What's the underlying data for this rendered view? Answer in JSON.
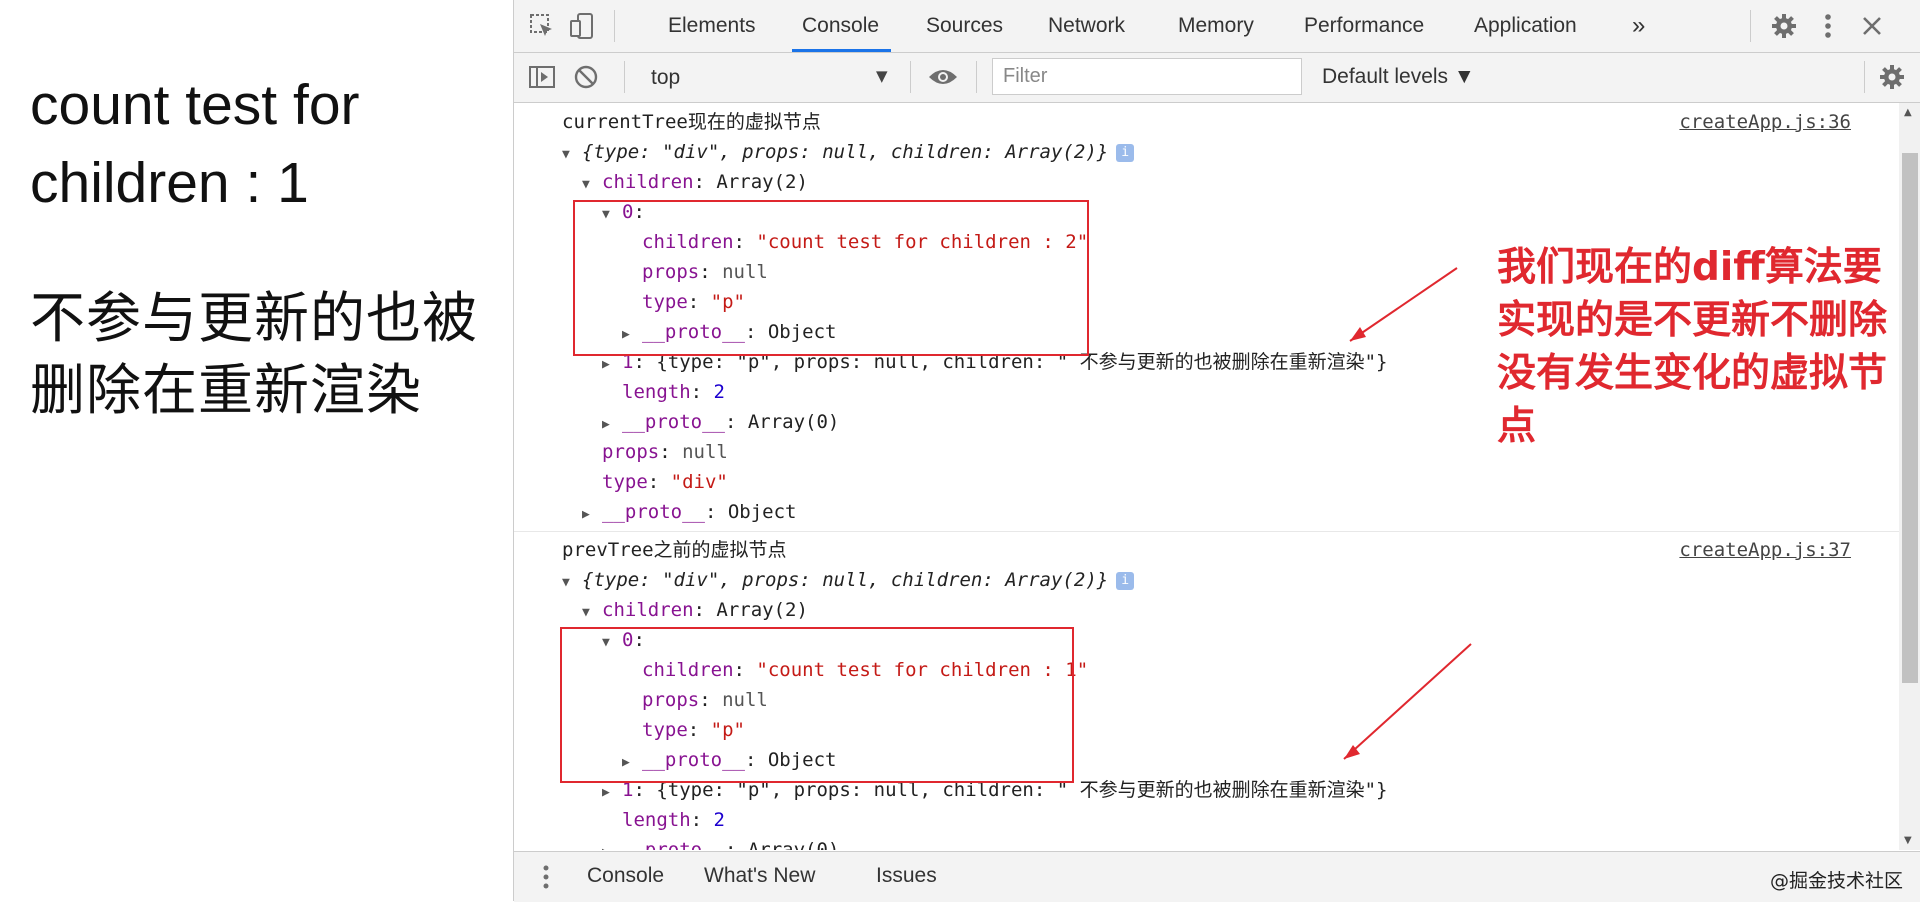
{
  "page": {
    "heading": "count test for children : 1",
    "subtext": "不参与更新的也被删除在重新渲染"
  },
  "devtools": {
    "tabs": [
      "Elements",
      "Console",
      "Sources",
      "Network",
      "Memory",
      "Performance",
      "Application"
    ],
    "active_tab": "Console",
    "more_tabs": "»",
    "toolbar": {
      "context": "top",
      "filter_placeholder": "Filter",
      "levels": "Default levels ▼"
    },
    "drawer_tabs": [
      "Console",
      "What's New",
      "Issues"
    ],
    "watermark": "@掘金技术社区"
  },
  "console": {
    "messages": [
      {
        "label": "currentTree现在的虚拟节点",
        "source": "createApp.js:36",
        "summary": "{type: \"div\", props: null, children: Array(2)}",
        "child0": "\"count test for children : 2\"",
        "child1": "{type: \"p\", props: null, children: \" 不参与更新的也被删除在重新渲染\"}"
      },
      {
        "label": "prevTree之前的虚拟节点",
        "source": "createApp.js:37",
        "summary": "{type: \"div\", props: null, children: Array(2)}",
        "child0": "\"count test for children : 1\"",
        "child1": "{type: \"p\", props: null, children: \" 不参与更新的也被删除在重新渲染\"}"
      }
    ],
    "annotation": "我们现在的diff算法要实现的是不更新不删除没有发生变化的虚拟节点"
  },
  "colors": {
    "annotation_red": "#e0282f",
    "tab_active_underline": "#1a73e8",
    "key_purple": "#881391",
    "string_red": "#c41a16",
    "number_blue": "#1c00cf"
  },
  "icons": [
    "inspect-icon",
    "device-toggle-icon",
    "settings-gear-icon",
    "more-vert-icon",
    "close-icon",
    "sidebar-toggle-icon",
    "clear-console-icon",
    "eye-icon",
    "console-settings-icon",
    "drawer-menu-icon"
  ]
}
